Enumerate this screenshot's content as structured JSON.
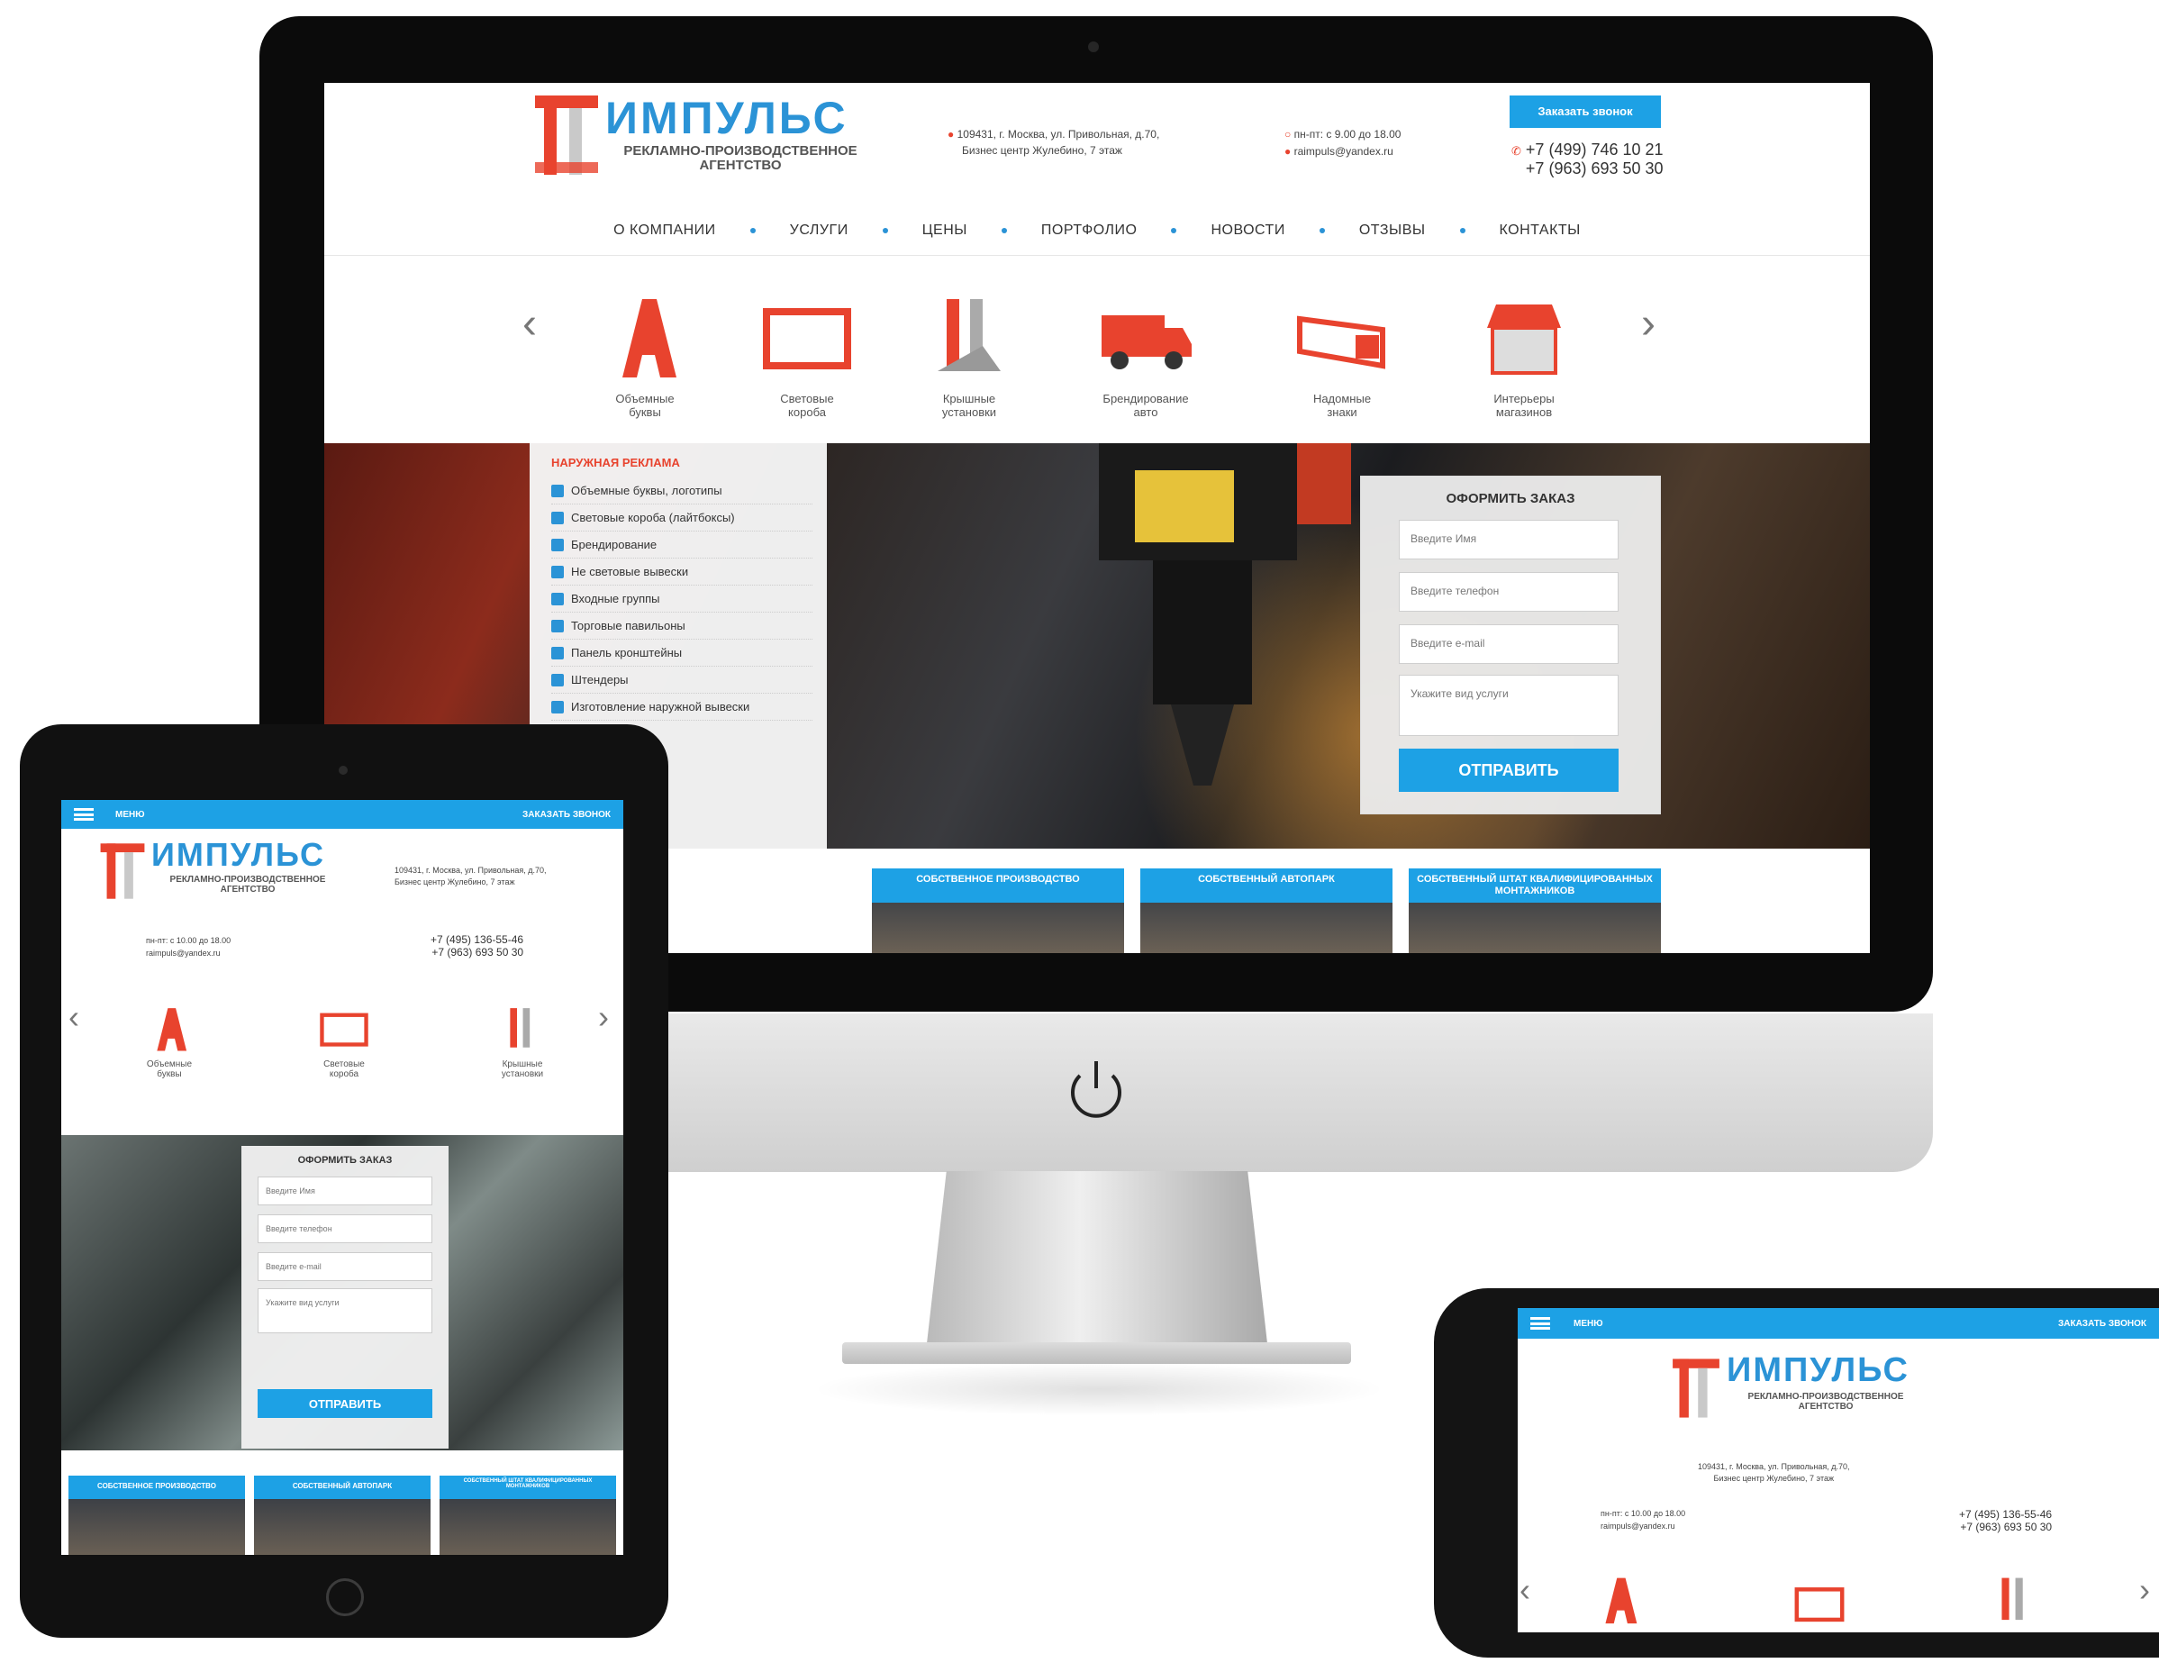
{
  "site": {
    "brand": "ИМПУЛЬС",
    "brand_sub_1": "РЕКЛАМНО-ПРОИЗВОДСТВЕННОЕ",
    "brand_sub_2": "АГЕНТСТВО",
    "address_1": "109431, г. Москва, ул. Привольная, д.70,",
    "address_2": "Бизнес центр Жулебино, 7 этаж",
    "hours_desktop": "пн-пт: с 9.00 до 18.00",
    "hours_mobile": "пн-пт: с 10.00 до 18.00",
    "email": "raimpuls@yandex.ru",
    "callback_button": "Заказать звонок",
    "phone_1": "+7 (499) 746 10 21",
    "phone_2": "+7 (963) 693 50 30",
    "mobile_phone_1": "+7 (495) 136-55-46",
    "mobile_phone_2": "+7 (963) 693 50 30"
  },
  "nav": [
    "О КОМПАНИИ",
    "УСЛУГИ",
    "ЦЕНЫ",
    "ПОРТФОЛИО",
    "НОВОСТИ",
    "ОТЗЫВЫ",
    "КОНТАКТЫ"
  ],
  "categories": [
    {
      "l1": "Объемные",
      "l2": "буквы"
    },
    {
      "l1": "Световые",
      "l2": "короба"
    },
    {
      "l1": "Крышные",
      "l2": "установки"
    },
    {
      "l1": "Брендирование",
      "l2": "авто"
    },
    {
      "l1": "Надомные",
      "l2": "знаки"
    },
    {
      "l1": "Интерьеры",
      "l2": "магазинов"
    }
  ],
  "sidebar": {
    "heading": "НАРУЖНАЯ РЕКЛАМА",
    "items": [
      "Объемные буквы, логотипы",
      "Световые короба (лайтбоксы)",
      "Брендирование",
      "Не световые вывески",
      "Входные группы",
      "Торговые павильоны",
      "Панель кронштейны",
      "Штендеры",
      "Изготовление наружной вывески"
    ]
  },
  "order_form": {
    "title": "ОФОРМИТЬ ЗАКАЗ",
    "name_placeholder": "Введите Имя",
    "phone_placeholder": "Введите телефон",
    "email_placeholder": "Введите e-mail",
    "service_placeholder": "Укажите вид услуги",
    "submit": "ОТПРАВИТЬ"
  },
  "features": [
    "СОБСТВЕННОЕ ПРОИЗВОДСТВО",
    "СОБСТВЕННЫЙ АВТОПАРК",
    "СОБСТВЕННЫЙ ШТАТ КВАЛИФИЦИРОВАННЫХ МОНТАЖНИКОВ"
  ],
  "mobile": {
    "menu_label": "МЕНЮ",
    "callback_label": "ЗАКАЗАТЬ ЗВОНОК"
  },
  "colors": {
    "accent": "#1da1e5",
    "brand_red": "#e8432e",
    "frame": "#0b0b0b"
  }
}
